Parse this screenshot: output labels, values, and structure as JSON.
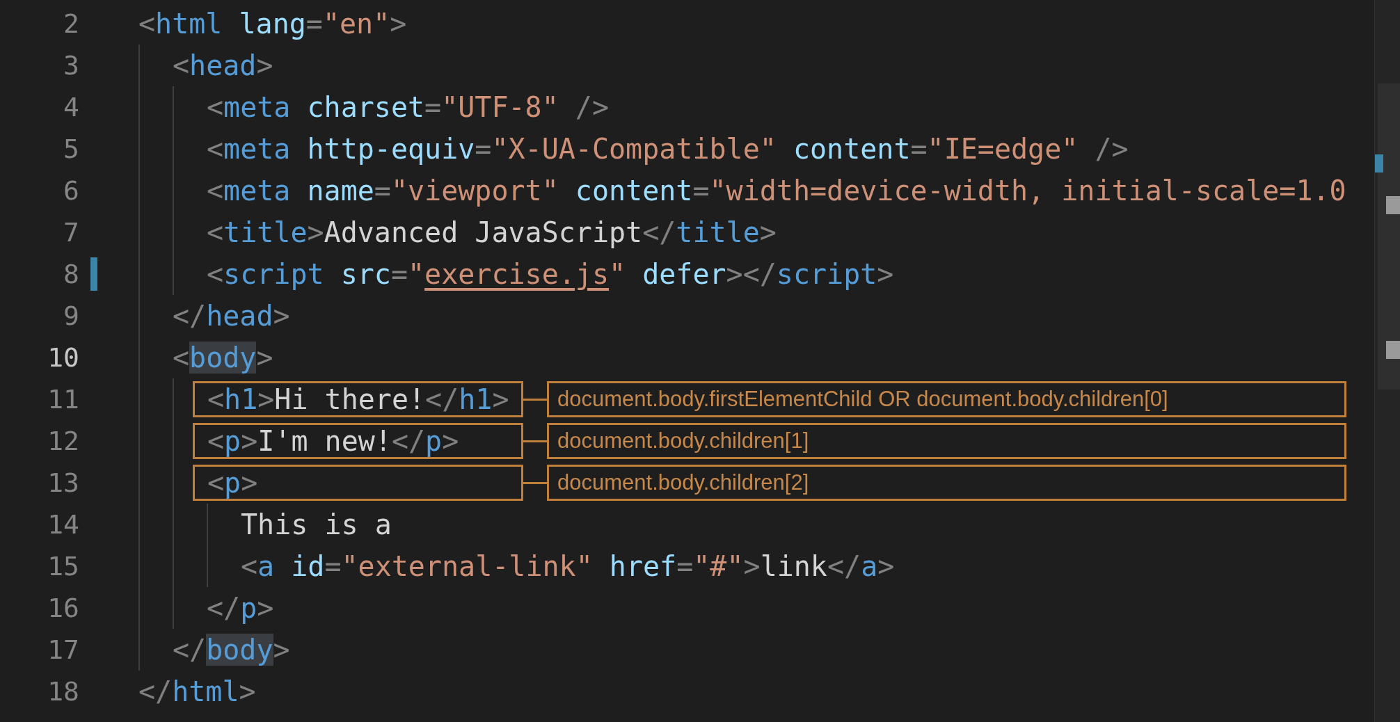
{
  "editor": {
    "lines": [
      {
        "number": "2",
        "current": false,
        "modified": false,
        "tokens": [
          {
            "kind": "punct",
            "text": "<"
          },
          {
            "kind": "tag",
            "text": "html"
          },
          {
            "kind": "attr",
            "text": " lang"
          },
          {
            "kind": "punct",
            "text": "="
          },
          {
            "kind": "string",
            "text": "\"en\""
          },
          {
            "kind": "punct",
            "text": ">"
          }
        ],
        "children": [
          {
            "number": "3",
            "current": false,
            "modified": false,
            "tokens": [
              {
                "kind": "punct",
                "text": "<"
              },
              {
                "kind": "tag",
                "text": "head"
              },
              {
                "kind": "punct",
                "text": ">"
              }
            ],
            "children": [
              {
                "number": "4",
                "current": false,
                "modified": false,
                "tokens": [
                  {
                    "kind": "punct",
                    "text": "<"
                  },
                  {
                    "kind": "tag",
                    "text": "meta"
                  },
                  {
                    "kind": "attr",
                    "text": " charset"
                  },
                  {
                    "kind": "punct",
                    "text": "="
                  },
                  {
                    "kind": "string",
                    "text": "\"UTF-8\""
                  },
                  {
                    "kind": "punct",
                    "text": " />"
                  }
                ]
              },
              {
                "number": "5",
                "current": false,
                "modified": false,
                "tokens": [
                  {
                    "kind": "punct",
                    "text": "<"
                  },
                  {
                    "kind": "tag",
                    "text": "meta"
                  },
                  {
                    "kind": "attr",
                    "text": " http-equiv"
                  },
                  {
                    "kind": "punct",
                    "text": "="
                  },
                  {
                    "kind": "string",
                    "text": "\"X-UA-Compatible\""
                  },
                  {
                    "kind": "attr",
                    "text": " content"
                  },
                  {
                    "kind": "punct",
                    "text": "="
                  },
                  {
                    "kind": "string",
                    "text": "\"IE=edge\""
                  },
                  {
                    "kind": "punct",
                    "text": " />"
                  }
                ]
              },
              {
                "number": "6",
                "current": false,
                "modified": false,
                "tokens": [
                  {
                    "kind": "punct",
                    "text": "<"
                  },
                  {
                    "kind": "tag",
                    "text": "meta"
                  },
                  {
                    "kind": "attr",
                    "text": " name"
                  },
                  {
                    "kind": "punct",
                    "text": "="
                  },
                  {
                    "kind": "string",
                    "text": "\"viewport\""
                  },
                  {
                    "kind": "attr",
                    "text": " content"
                  },
                  {
                    "kind": "punct",
                    "text": "="
                  },
                  {
                    "kind": "string",
                    "text": "\"width=device-width, initial-scale=1.0"
                  }
                ]
              },
              {
                "number": "7",
                "current": false,
                "modified": false,
                "tokens": [
                  {
                    "kind": "punct",
                    "text": "<"
                  },
                  {
                    "kind": "tag",
                    "text": "title"
                  },
                  {
                    "kind": "punct",
                    "text": ">"
                  },
                  {
                    "kind": "text",
                    "text": "Advanced JavaScript"
                  },
                  {
                    "kind": "punct",
                    "text": "</"
                  },
                  {
                    "kind": "tag",
                    "text": "title"
                  },
                  {
                    "kind": "punct",
                    "text": ">"
                  }
                ]
              },
              {
                "number": "8",
                "current": false,
                "modified": true,
                "tokens": [
                  {
                    "kind": "punct",
                    "text": "<"
                  },
                  {
                    "kind": "tag",
                    "text": "script"
                  },
                  {
                    "kind": "attr",
                    "text": " src"
                  },
                  {
                    "kind": "punct",
                    "text": "="
                  },
                  {
                    "kind": "string",
                    "text": "\""
                  },
                  {
                    "kind": "link",
                    "text": "exercise.js"
                  },
                  {
                    "kind": "string",
                    "text": "\""
                  },
                  {
                    "kind": "attr",
                    "text": " defer"
                  },
                  {
                    "kind": "punct",
                    "text": "></"
                  },
                  {
                    "kind": "tag",
                    "text": "script"
                  },
                  {
                    "kind": "punct",
                    "text": ">"
                  }
                ]
              }
            ]
          },
          {
            "number": "9",
            "current": false,
            "modified": false,
            "tokens": [
              {
                "kind": "punct",
                "text": "</"
              },
              {
                "kind": "tag",
                "text": "head"
              },
              {
                "kind": "punct",
                "text": ">"
              }
            ]
          },
          {
            "number": "10",
            "current": true,
            "modified": false,
            "tokens": [
              {
                "kind": "punct",
                "text": "<"
              },
              {
                "kind": "tag",
                "text": "body",
                "highlight": true
              },
              {
                "kind": "punct",
                "text": ">"
              }
            ],
            "children": [
              {
                "number": "11",
                "current": false,
                "modified": false,
                "annotation": "document.body.firstElementChild OR document.body.children[0]",
                "tokens": [
                  {
                    "kind": "punct",
                    "text": "<"
                  },
                  {
                    "kind": "tag",
                    "text": "h1"
                  },
                  {
                    "kind": "punct",
                    "text": ">"
                  },
                  {
                    "kind": "text",
                    "text": "Hi there!"
                  },
                  {
                    "kind": "punct",
                    "text": "</"
                  },
                  {
                    "kind": "tag",
                    "text": "h1"
                  },
                  {
                    "kind": "punct",
                    "text": ">"
                  }
                ]
              },
              {
                "number": "12",
                "current": false,
                "modified": false,
                "annotation": "document.body.children[1]",
                "tokens": [
                  {
                    "kind": "punct",
                    "text": "<"
                  },
                  {
                    "kind": "tag",
                    "text": "p"
                  },
                  {
                    "kind": "punct",
                    "text": ">"
                  },
                  {
                    "kind": "text",
                    "text": "I'm new!"
                  },
                  {
                    "kind": "punct",
                    "text": "</"
                  },
                  {
                    "kind": "tag",
                    "text": "p"
                  },
                  {
                    "kind": "punct",
                    "text": ">"
                  }
                ]
              },
              {
                "number": "13",
                "current": false,
                "modified": false,
                "annotation": "document.body.children[2]",
                "tokens": [
                  {
                    "kind": "punct",
                    "text": "<"
                  },
                  {
                    "kind": "tag",
                    "text": "p"
                  },
                  {
                    "kind": "punct",
                    "text": ">"
                  }
                ],
                "children": [
                  {
                    "number": "14",
                    "current": false,
                    "modified": false,
                    "tokens": [
                      {
                        "kind": "text",
                        "text": "This is a"
                      }
                    ]
                  },
                  {
                    "number": "15",
                    "current": false,
                    "modified": false,
                    "tokens": [
                      {
                        "kind": "punct",
                        "text": "<"
                      },
                      {
                        "kind": "tag",
                        "text": "a"
                      },
                      {
                        "kind": "attr",
                        "text": " id"
                      },
                      {
                        "kind": "punct",
                        "text": "="
                      },
                      {
                        "kind": "string",
                        "text": "\"external-link\""
                      },
                      {
                        "kind": "attr",
                        "text": " href"
                      },
                      {
                        "kind": "punct",
                        "text": "="
                      },
                      {
                        "kind": "string",
                        "text": "\"#\""
                      },
                      {
                        "kind": "punct",
                        "text": ">"
                      },
                      {
                        "kind": "text",
                        "text": "link"
                      },
                      {
                        "kind": "punct",
                        "text": "</"
                      },
                      {
                        "kind": "tag",
                        "text": "a"
                      },
                      {
                        "kind": "punct",
                        "text": ">"
                      }
                    ]
                  }
                ]
              },
              {
                "number": "16",
                "current": false,
                "modified": false,
                "tokens": [
                  {
                    "kind": "punct",
                    "text": "</"
                  },
                  {
                    "kind": "tag",
                    "text": "p"
                  },
                  {
                    "kind": "punct",
                    "text": ">"
                  }
                ]
              }
            ]
          },
          {
            "number": "17",
            "current": false,
            "modified": false,
            "tokens": [
              {
                "kind": "punct",
                "text": "</"
              },
              {
                "kind": "tag",
                "text": "body",
                "highlight": true
              },
              {
                "kind": "punct",
                "text": ">"
              }
            ]
          }
        ]
      },
      {
        "number": "18",
        "current": false,
        "modified": false,
        "tokens": [
          {
            "kind": "punct",
            "text": "</"
          },
          {
            "kind": "tag",
            "text": "html"
          },
          {
            "kind": "punct",
            "text": ">"
          }
        ]
      }
    ]
  }
}
